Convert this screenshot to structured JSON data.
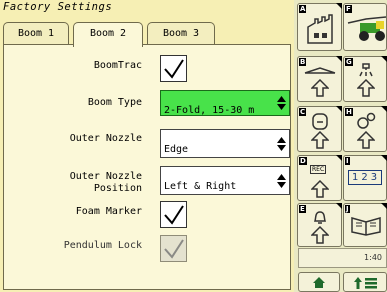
{
  "window": {
    "title": "Factory Settings"
  },
  "tabs": [
    {
      "label": "Boom 1"
    },
    {
      "label": "Boom 2"
    },
    {
      "label": "Boom 3"
    }
  ],
  "settings": {
    "boomtrac": {
      "label": "BoomTrac",
      "checked": true
    },
    "boom_type": {
      "label": "Boom Type",
      "value": "2-Fold, 15-30 m"
    },
    "outer_nozzle": {
      "label": "Outer Nozzle",
      "value": "Edge"
    },
    "outer_nozzle_position": {
      "label": "Outer Nozzle\nPosition",
      "value": "Left & Right"
    },
    "foam_marker": {
      "label": "Foam Marker",
      "checked": true
    },
    "pendulum_lock": {
      "label": "Pendulum Lock",
      "checked": true,
      "disabled": true
    }
  },
  "sidebar": {
    "shortcut_letters": [
      "A",
      "B",
      "C",
      "D",
      "E",
      "F",
      "G",
      "H",
      "I",
      "J"
    ],
    "page_numbers": "123",
    "ref_label": "REC",
    "clock": "1:40"
  },
  "colors": {
    "background": "#f6efb4",
    "panel": "#fbf8d8",
    "selected_field": "#48e24a",
    "sidebar": "#e9e9c3"
  }
}
